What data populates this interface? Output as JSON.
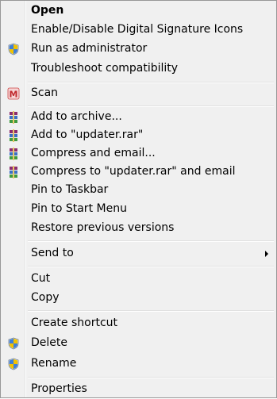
{
  "menu": {
    "open": "Open",
    "digital_signature": "Enable/Disable Digital Signature Icons",
    "run_as_admin": "Run as administrator",
    "troubleshoot": "Troubleshoot compatibility",
    "scan": "Scan",
    "add_to_archive": "Add to archive...",
    "add_to_rar": "Add to \"updater.rar\"",
    "compress_email": "Compress and email...",
    "compress_rar_email": "Compress to \"updater.rar\" and email",
    "pin_taskbar": "Pin to Taskbar",
    "pin_start": "Pin to Start Menu",
    "restore_versions": "Restore previous versions",
    "send_to": "Send to",
    "cut": "Cut",
    "copy": "Copy",
    "create_shortcut": "Create shortcut",
    "delete": "Delete",
    "rename": "Rename",
    "properties": "Properties"
  },
  "icons": {
    "shield": "uac-shield-icon",
    "scan": "malwarebytes-icon",
    "winrar": "winrar-icon"
  }
}
